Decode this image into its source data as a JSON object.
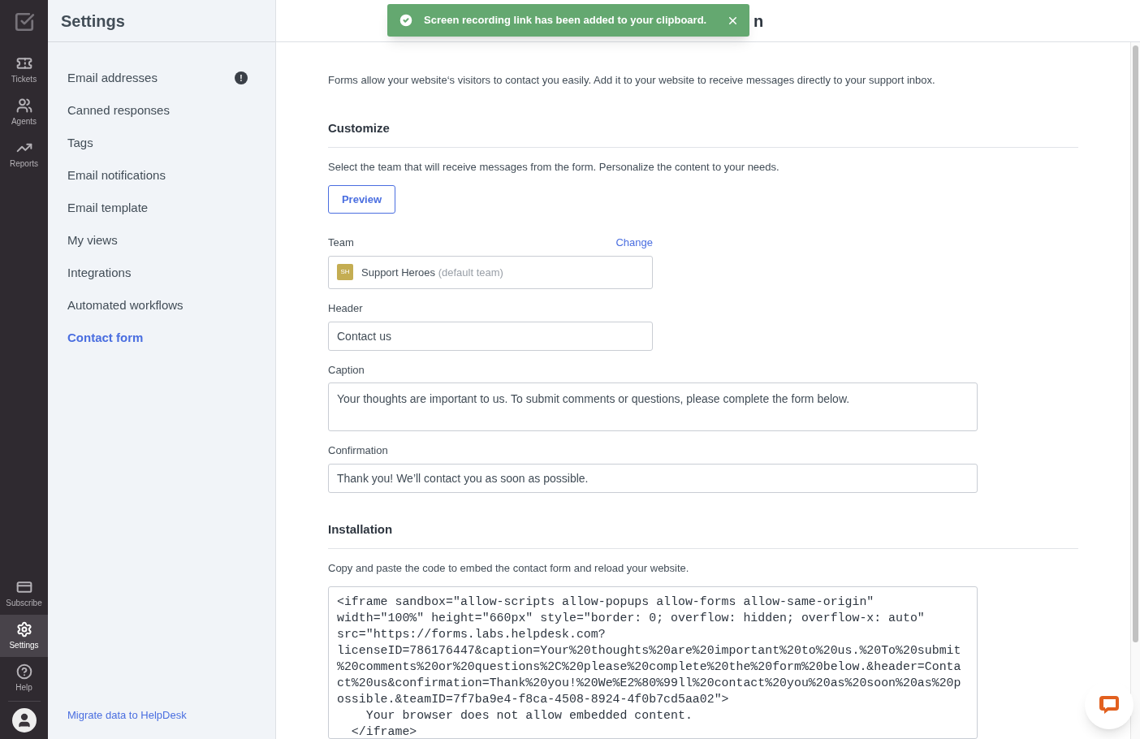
{
  "rail": {
    "top": [
      {
        "kind": "tickets",
        "label": "Tickets",
        "selected": false
      },
      {
        "kind": "agents",
        "label": "Agents",
        "selected": false
      },
      {
        "kind": "reports",
        "label": "Reports",
        "selected": false
      }
    ],
    "bottom": [
      {
        "kind": "subscribe",
        "label": "Subscribe",
        "selected": false
      },
      {
        "kind": "settings",
        "label": "Settings",
        "selected": true
      },
      {
        "kind": "help",
        "label": "Help",
        "selected": false
      }
    ]
  },
  "settings_panel": {
    "title": "Settings",
    "items": [
      {
        "label": "Email addresses",
        "selected": false,
        "alert": "!"
      },
      {
        "label": "Canned responses",
        "selected": false
      },
      {
        "label": "Tags",
        "selected": false
      },
      {
        "label": "Email notifications",
        "selected": false
      },
      {
        "label": "Email template",
        "selected": false
      },
      {
        "label": "My views",
        "selected": false
      },
      {
        "label": "Integrations",
        "selected": false
      },
      {
        "label": "Automated workflows",
        "selected": false
      },
      {
        "label": "Contact form",
        "selected": true
      }
    ],
    "footer_link": "Migrate data to HelpDesk"
  },
  "header": {
    "title": "n"
  },
  "toast": {
    "message": "Screen recording link has been added to your clipboard."
  },
  "intro": "Forms allow your website‘s visitors to contact you easily. Add it to your website to receive messages directly to your support inbox.",
  "customize": {
    "heading": "Customize",
    "description": "Select the team that will receive messages from the form. Personalize the content to your needs.",
    "preview_button": "Preview",
    "team": {
      "label": "Team",
      "change_link": "Change",
      "badge": "SH",
      "name": "Support Heroes",
      "note": "(default team)"
    },
    "header_field": {
      "label": "Header",
      "value": "Contact us"
    },
    "caption_field": {
      "label": "Caption",
      "value": "Your thoughts are important to us. To submit comments or questions, please complete the form below."
    },
    "confirmation_field": {
      "label": "Confirmation",
      "value": "Thank you! We’ll contact you as soon as possible."
    }
  },
  "installation": {
    "heading": "Installation",
    "description": "Copy and paste the code to embed the contact form and reload your website.",
    "code_lines": [
      "<iframe sandbox=\"allow-scripts allow-popups allow-forms allow-same-origin\"",
      "width=\"100%\" height=\"660px\" style=\"border: 0; overflow: hidden; overflow-x: auto\"",
      "src=\"https://forms.labs.helpdesk.com?",
      "licenseID=786176447&caption=Your%20thoughts%20are%20important%20to%20us.%20To%20submit",
      "%20comments%20or%20questions%2C%20please%20complete%20the%20form%20below.&header=Conta",
      "ct%20us&confirmation=Thank%20you!%20We%E2%80%99ll%20contact%20you%20as%20soon%20as%20p",
      "ossible.&teamID=7f7ba9e4-f8ca-4508-8924-4f0b7cd5aa02\">",
      "    Your browser does not allow embedded content.",
      "  </iframe>"
    ]
  }
}
